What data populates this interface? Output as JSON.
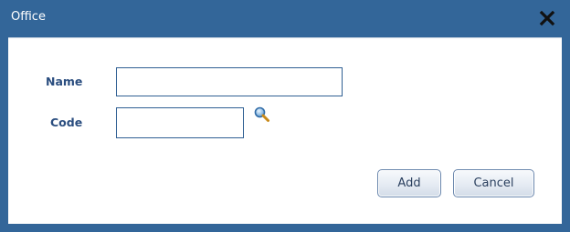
{
  "dialog": {
    "title": "Office",
    "close_icon": "close-icon"
  },
  "form": {
    "name_label": "Name",
    "name_value": "",
    "code_label": "Code",
    "code_value": "",
    "lookup_icon": "search-icon"
  },
  "buttons": {
    "add_label": "Add",
    "cancel_label": "Cancel"
  },
  "colors": {
    "titlebar": "#336699",
    "label_text": "#2a4d7f",
    "input_border": "#2f5f93"
  }
}
